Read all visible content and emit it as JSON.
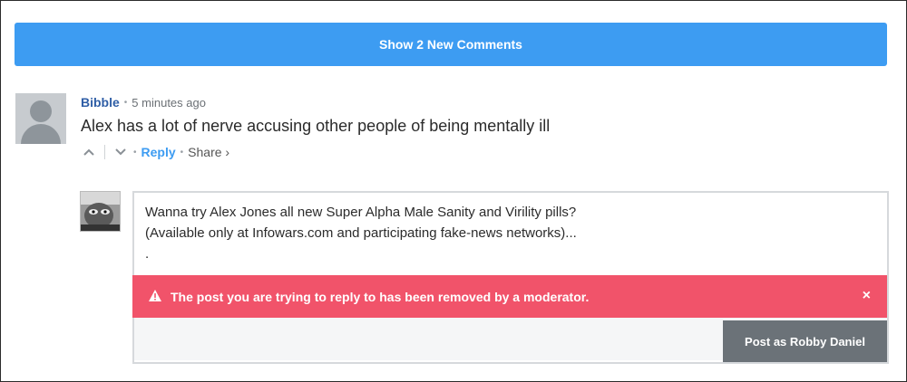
{
  "banner": {
    "show_new_label": "Show 2 New Comments"
  },
  "comment": {
    "author": "Bibble",
    "separator": "•",
    "time": "5 minutes ago",
    "text": "Alex has a lot of nerve accusing other people of being mentally ill",
    "actions": {
      "reply_label": "Reply",
      "share_label": "Share ›"
    }
  },
  "reply_form": {
    "text": "Wanna try Alex Jones all new Super Alpha Male Sanity and Virility pills?\n(Available only at Infowars.com and participating fake-news networks)...\n.",
    "alert": "The post you are trying to reply to has been removed by a moderator.",
    "alert_close": "×",
    "post_label": "Post as Robby Daniel"
  },
  "colors": {
    "accent": "#3d9cf2",
    "alert": "#f1536a",
    "author": "#2f5ea6",
    "post_button": "#6b7278"
  },
  "icons": [
    "upvote-icon",
    "downvote-icon",
    "warning-icon",
    "close-icon",
    "default-avatar-icon"
  ]
}
